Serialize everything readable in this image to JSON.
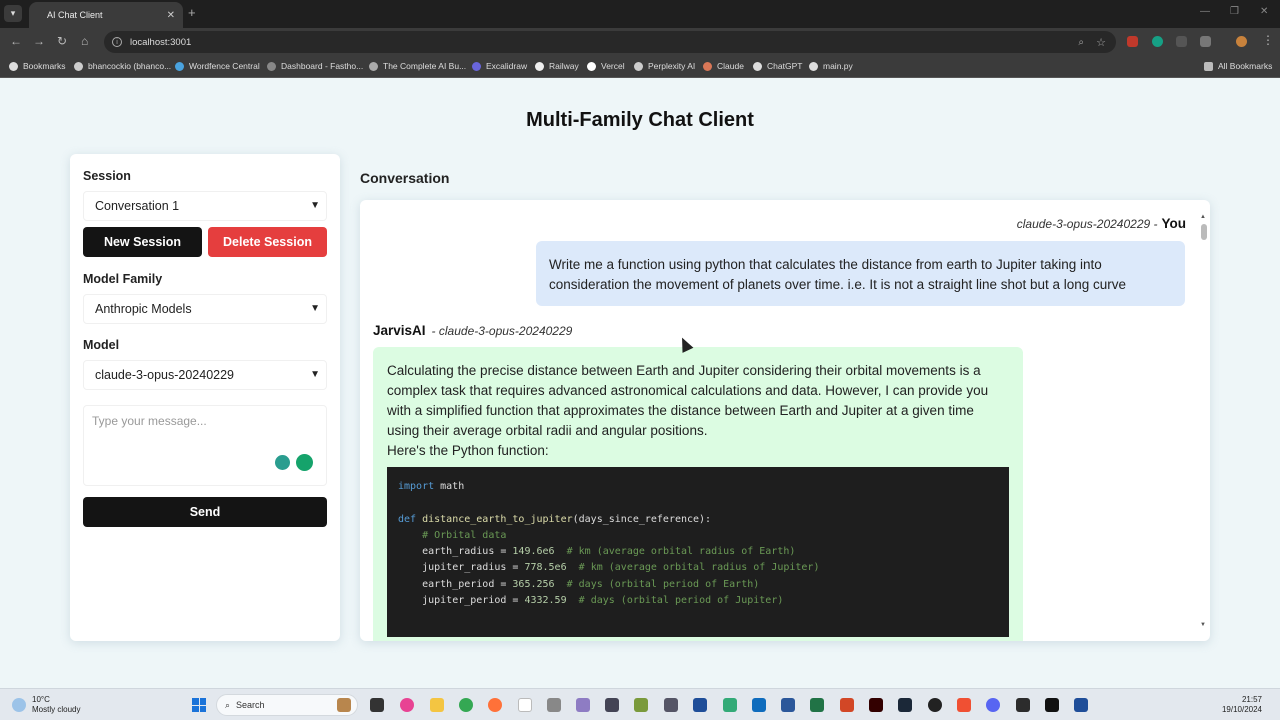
{
  "browser": {
    "tab_title": "AI Chat Client",
    "tab_close": "✕",
    "new_tab": "+",
    "url": "localhost:3001",
    "bookmarks": [
      {
        "label": "Bookmarks",
        "color": "#dddddd"
      },
      {
        "label": "bhancockio (bhanco...",
        "color": "#cccccc"
      },
      {
        "label": "Wordfence Central",
        "color": "#4aa3df"
      },
      {
        "label": "Dashboard - Fastho...",
        "color": "#888888"
      },
      {
        "label": "The Complete AI Bu...",
        "color": "#aaaaaa"
      },
      {
        "label": "Excalidraw",
        "color": "#6965db"
      },
      {
        "label": "Railway",
        "color": "#eeeeee"
      },
      {
        "label": "Vercel",
        "color": "#ffffff"
      },
      {
        "label": "Perplexity AI",
        "color": "#cccccc"
      },
      {
        "label": "Claude",
        "color": "#d97757"
      },
      {
        "label": "ChatGPT",
        "color": "#dddddd"
      },
      {
        "label": "main.py",
        "color": "#dddddd"
      }
    ],
    "all_bookmarks": "All Bookmarks"
  },
  "page": {
    "title": "Multi-Family Chat Client"
  },
  "sidebar": {
    "session_label": "Session",
    "session_value": "Conversation 1",
    "new_session": "New Session",
    "delete_session": "Delete Session",
    "family_label": "Model Family",
    "family_value": "Anthropic Models",
    "model_label": "Model",
    "model_value": "claude-3-opus-20240229",
    "message_placeholder": "Type your message...",
    "send": "Send"
  },
  "conversation": {
    "title": "Conversation",
    "user_message": {
      "model": "claude-3-opus-20240229 -",
      "author": "You",
      "text": "Write me a function using python that calculates the distance from earth to Jupiter taking into consideration the movement of planets over time. i.e. It is not a straight line shot but a long curve"
    },
    "assistant_message": {
      "author": "JarvisAI",
      "model": "- claude-3-opus-20240229",
      "text": "Calculating the precise distance between Earth and Jupiter considering their orbital movements is a complex task that requires advanced astronomical calculations and data. However, I can provide you with a simplified function that approximates the distance between Earth and Jupiter at a given time using their average orbital radii and angular positions.",
      "text2": "Here's the Python function:",
      "code": {
        "l1_kw": "import",
        "l1_rest": " math",
        "l3_kw": "def",
        "l3_fn": "distance_earth_to_jupiter",
        "l3_rest": "(days_since_reference):",
        "l4_cm": "# Orbital data",
        "l5_var": "earth_radius = ",
        "l5_num": "149.6e6",
        "l5_cm": "# km (average orbital radius of Earth)",
        "l6_var": "jupiter_radius = ",
        "l6_num": "778.5e6",
        "l6_cm": "# km (average orbital radius of Jupiter)",
        "l7_var": "earth_period = ",
        "l7_num": "365.256",
        "l7_cm": "# days (orbital period of Earth)",
        "l8_var": "jupiter_period = ",
        "l8_num": "4332.59",
        "l8_cm": "# days (orbital period of Jupiter)"
      }
    }
  },
  "taskbar": {
    "temperature": "10°C",
    "weather": "Mostly cloudy",
    "search": "Search",
    "time": "21:57",
    "date": "19/10/2024"
  }
}
